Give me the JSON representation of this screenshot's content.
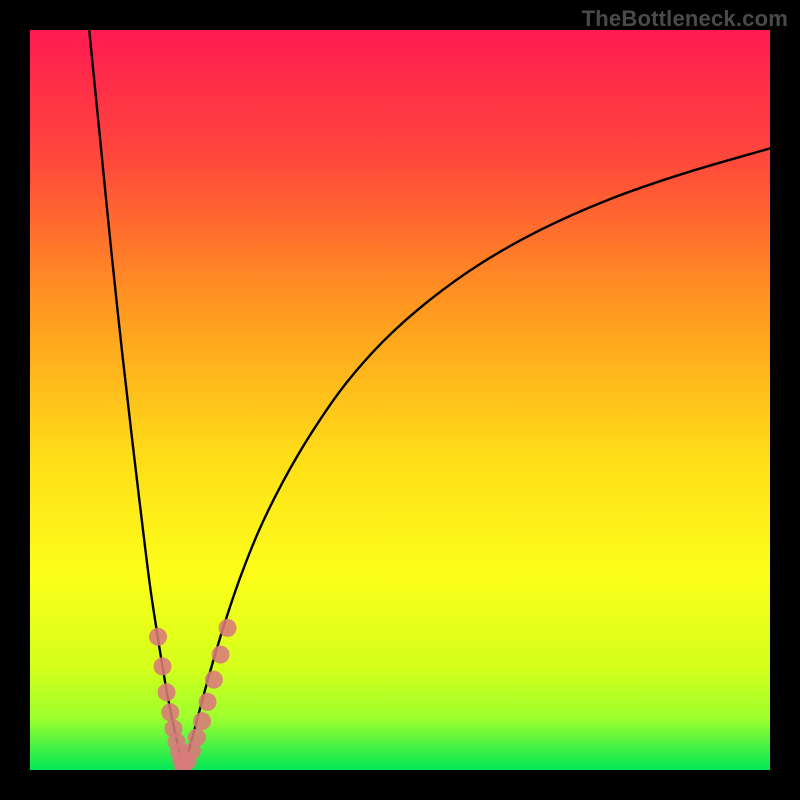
{
  "watermark": "TheBottleneck.com",
  "chart_data": {
    "type": "line",
    "title": "",
    "xlabel": "",
    "ylabel": "",
    "xlim": [
      0,
      100
    ],
    "ylim": [
      0,
      100
    ],
    "grid": false,
    "legend": false,
    "background_gradient": {
      "top_color": "#ff1a52",
      "mid_colors": [
        "#ff6a2a",
        "#ffb91d",
        "#fff71a",
        "#d9ff1a"
      ],
      "bottom_color": "#00e756"
    },
    "series": [
      {
        "name": "left-branch",
        "x": [
          8.0,
          9.5,
          11.0,
          12.5,
          14.0,
          15.2,
          16.2,
          17.1,
          17.9,
          18.6,
          19.2,
          19.7,
          20.1,
          20.45,
          20.7
        ],
        "y": [
          100.0,
          85.0,
          70.0,
          56.0,
          43.0,
          33.0,
          25.0,
          19.0,
          14.0,
          10.0,
          7.0,
          4.6,
          2.8,
          1.4,
          0.3
        ]
      },
      {
        "name": "right-branch",
        "x": [
          20.7,
          21.7,
          22.9,
          24.4,
          26.2,
          28.4,
          31.0,
          34.2,
          38.0,
          42.5,
          47.8,
          54.0,
          61.0,
          69.0,
          78.0,
          88.0,
          100.0
        ],
        "y": [
          0.3,
          3.5,
          8.0,
          13.5,
          19.5,
          26.0,
          32.5,
          39.0,
          45.5,
          52.0,
          58.0,
          63.5,
          68.5,
          73.0,
          77.0,
          80.5,
          84.0
        ]
      }
    ],
    "markers": {
      "name": "highlight-dots",
      "color": "#d97a7a",
      "radius_px": 9,
      "points": [
        {
          "x": 17.3,
          "y": 18.0
        },
        {
          "x": 17.9,
          "y": 14.0
        },
        {
          "x": 18.45,
          "y": 10.5
        },
        {
          "x": 18.95,
          "y": 7.8
        },
        {
          "x": 19.38,
          "y": 5.6
        },
        {
          "x": 19.8,
          "y": 3.8
        },
        {
          "x": 20.15,
          "y": 2.4
        },
        {
          "x": 20.45,
          "y": 1.3
        },
        {
          "x": 20.7,
          "y": 0.3
        },
        {
          "x": 21.3,
          "y": 1.2
        },
        {
          "x": 21.9,
          "y": 2.6
        },
        {
          "x": 22.55,
          "y": 4.4
        },
        {
          "x": 23.25,
          "y": 6.6
        },
        {
          "x": 24.0,
          "y": 9.2
        },
        {
          "x": 24.85,
          "y": 12.2
        },
        {
          "x": 25.75,
          "y": 15.6
        },
        {
          "x": 26.7,
          "y": 19.2
        }
      ]
    }
  }
}
